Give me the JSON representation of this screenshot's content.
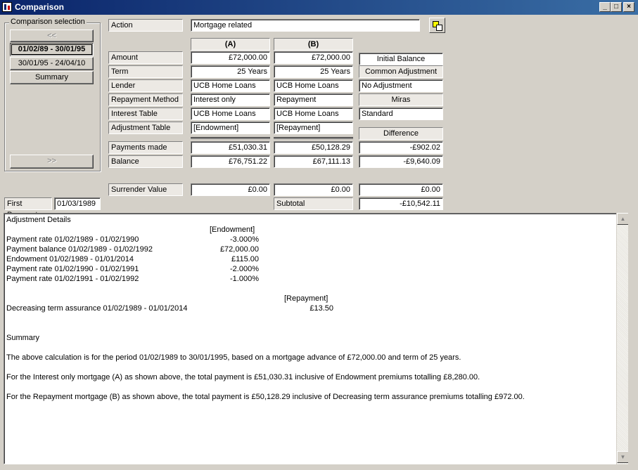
{
  "window": {
    "title": "Comparison"
  },
  "selection": {
    "label": "Comparison selection",
    "prev_label": "<<",
    "next_label": ">>",
    "periods": [
      "01/02/89 - 30/01/95",
      "30/01/95 - 24/04/10"
    ],
    "summary_label": "Summary"
  },
  "action": {
    "label": "Action",
    "value": "Mortgage related"
  },
  "columns": {
    "a": "(A)",
    "b": "(B)"
  },
  "rows": {
    "amount": {
      "label": "Amount",
      "a": "£72,000.00",
      "b": "£72,000.00"
    },
    "term": {
      "label": "Term",
      "a": "25 Years",
      "b": "25 Years"
    },
    "lender": {
      "label": "Lender",
      "a": "UCB Home Loans",
      "b": "UCB Home Loans"
    },
    "repayment_method": {
      "label": "Repayment Method",
      "a": "Interest only",
      "b": "Repayment"
    },
    "interest_table": {
      "label": "Interest Table",
      "a": "UCB Home Loans",
      "b": "UCB Home Loans"
    },
    "adjustment_table": {
      "label": "Adjustment Table",
      "a": "[Endowment]",
      "b": "[Repayment]"
    },
    "payments_made": {
      "label": "Payments made",
      "a": "£51,030.31",
      "b": "£50,128.29",
      "diff": "-£902.02"
    },
    "balance": {
      "label": "Balance",
      "a": "£76,751.22",
      "b": "£67,111.13",
      "diff": "-£9,640.09"
    },
    "surrender": {
      "label": "Surrender Value",
      "a": "£0.00",
      "b": "£0.00",
      "diff": "£0.00"
    }
  },
  "side": {
    "initial_balance": "Initial Balance",
    "common_adjustment": "Common Adjustment",
    "no_adjustment": "No Adjustment",
    "miras": "Miras",
    "standard": "Standard",
    "difference": "Difference"
  },
  "first_payment": {
    "label": "First Payment",
    "value": "01/03/1989"
  },
  "subtotal": {
    "label": "Subtotal",
    "value": "-£10,542.11"
  },
  "details": {
    "heading": "Adjustment Details",
    "endowment_title": "[Endowment]",
    "endowment_lines": [
      {
        "desc": "Payment rate 01/02/1989 - 01/02/1990",
        "value": "-3.000%"
      },
      {
        "desc": "Payment balance 01/02/1989 - 01/02/1992",
        "value": "£72,000.00"
      },
      {
        "desc": "Endowment 01/02/1989 - 01/01/2014",
        "value": "£115.00"
      },
      {
        "desc": "Payment rate 01/02/1990 - 01/02/1991",
        "value": "-2.000%"
      },
      {
        "desc": "Payment rate 01/02/1991 - 01/02/1992",
        "value": "-1.000%"
      }
    ],
    "repayment_title": "[Repayment]",
    "repayment_lines": [
      {
        "desc": "Decreasing term assurance 01/02/1989 - 01/01/2014",
        "value": "£13.50"
      }
    ],
    "summary_heading": "Summary",
    "summary_paragraphs": [
      "The above calculation is for the period 01/02/1989 to 30/01/1995, based on a mortgage advance of £72,000.00 and term of 25 years.",
      "For the Interest only mortgage (A) as shown above, the total payment is £51,030.31 inclusive of Endowment premiums totalling £8,280.00.",
      "For the Repayment mortgage (B) as shown above, the total payment is £50,128.29 inclusive of Decreasing term assurance premiums totalling £972.00."
    ]
  },
  "colors": {
    "titlebar": "#0a246a",
    "face": "#d4d0c8",
    "label_bg": "#ece9e4"
  }
}
